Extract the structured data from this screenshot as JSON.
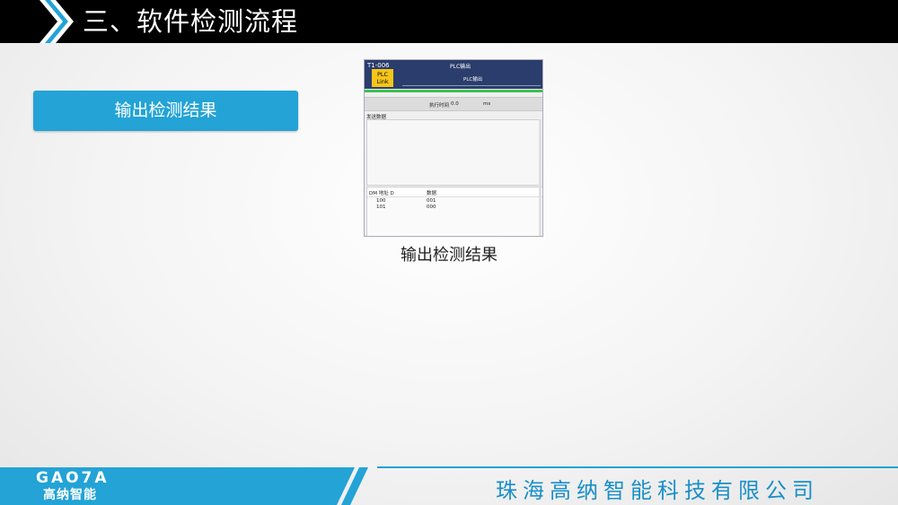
{
  "header": {
    "title": "三、软件检测流程"
  },
  "left_button": {
    "label": "输出检测结果"
  },
  "screenshot": {
    "tool_id": "T1-006",
    "window_title": "PLC输出",
    "plc_badge": [
      "PLC",
      "Link"
    ],
    "subtitle": "PLC输出",
    "exec_time_label": "执行时间",
    "exec_time_value": "0.0",
    "exec_time_unit": "ms",
    "send_data_label": "发送数据",
    "table": {
      "headers": [
        "DM 地址 D",
        "数据"
      ],
      "rows": [
        [
          "100",
          "001"
        ],
        [
          "101",
          "000"
        ]
      ]
    }
  },
  "caption": "输出检测结果",
  "footer": {
    "logo_text": "GAO7A",
    "logo_cn": "高纳智能",
    "company": "珠海高纳智能科技有限公司"
  },
  "colors": {
    "accent": "#23a3d6",
    "header_bg": "#000000",
    "footer_blue": "#1a8fc8"
  }
}
